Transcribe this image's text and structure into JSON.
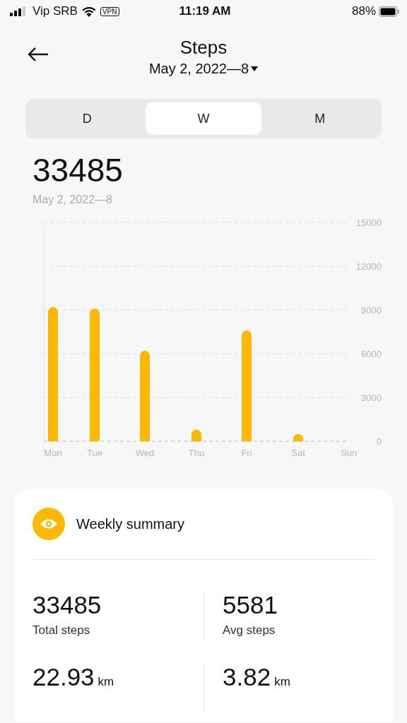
{
  "status_bar": {
    "carrier": "Vip SRB",
    "vpn": "VPN",
    "time": "11:19 AM",
    "battery": "88%"
  },
  "header": {
    "title": "Steps",
    "date": "May 2, 2022—8"
  },
  "tabs": [
    {
      "label": "D",
      "selected": false
    },
    {
      "label": "W",
      "selected": true
    },
    {
      "label": "M",
      "selected": false
    }
  ],
  "total": {
    "value": "33485",
    "date_range": "May 2, 2022—8"
  },
  "chart": {
    "chart_data": {
      "type": "bar",
      "categories": [
        "Mon",
        "Tue",
        "Wed",
        "Thu",
        "Fri",
        "Sat",
        "Sun"
      ],
      "series": [
        {
          "color": "#ffb800",
          "values": [
            9200,
            9100,
            6200,
            800,
            7600,
            500,
            null
          ]
        }
      ],
      "grid": true,
      "ylim": [
        0,
        15000
      ],
      "yticks": [
        0,
        3000,
        6000,
        9000,
        12000,
        15000
      ]
    }
  },
  "summary": {
    "title": "Weekly summary",
    "stats": [
      {
        "value": "33485",
        "label": "Total steps"
      },
      {
        "value": "5581",
        "label": "Avg steps"
      },
      {
        "value": "22.93",
        "unit": "km"
      },
      {
        "value": "3.82",
        "unit": "km"
      }
    ]
  }
}
